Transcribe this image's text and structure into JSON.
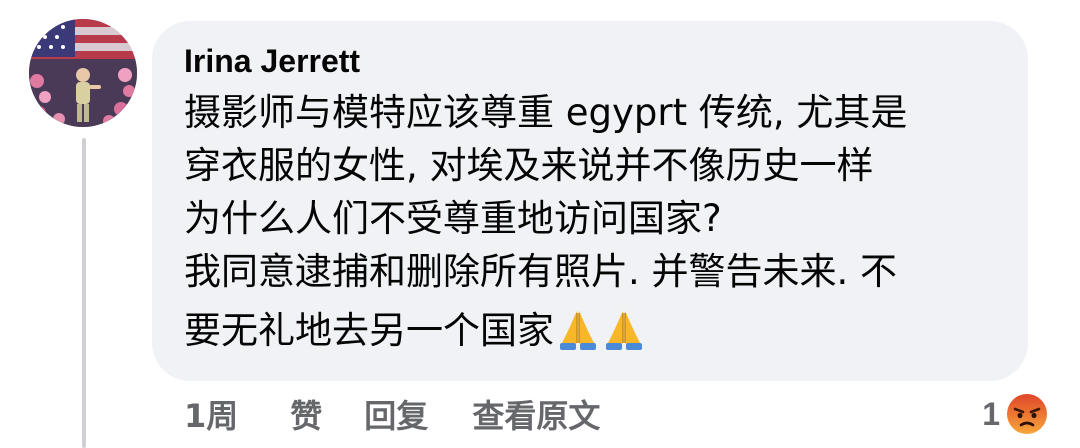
{
  "comment": {
    "author": "Irina Jerrett",
    "lines": [
      "摄影师与模特应该尊重 egyprt 传统, 尤其是",
      "穿衣服的女性, 对埃及来说并不像历史一样",
      "为什么人们不受尊重地访问国家?",
      "我同意逮捕和删除所有照片. 并警告未来. 不",
      "要无礼地去另一个国家"
    ],
    "emojis": [
      "folded-hands",
      "folded-hands"
    ]
  },
  "actions": {
    "time": "1周",
    "like": "赞",
    "reply": "回复",
    "see_translation": "查看原文"
  },
  "reactions": {
    "count": "1",
    "type": "angry",
    "color": "#f0643c"
  }
}
